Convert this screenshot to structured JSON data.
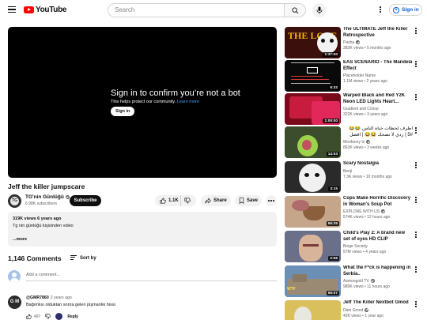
{
  "header": {
    "logo_text": "YouTube",
    "search_placeholder": "Search",
    "signin_label": "Sign in"
  },
  "player": {
    "overlay_title": "Sign in to confirm you’re not a bot",
    "overlay_subtitle": "This helps protect our community.",
    "overlay_link": "Learn more",
    "overlay_button": "Sign in"
  },
  "video": {
    "title": "Jeff the killer jumpscare",
    "channel_name": "TG'nin Günlüğü",
    "channel_avatar_text": "TG",
    "subscribers": "6.98K subscribers",
    "subscribe_label": "Subscribe",
    "likes": "1.1K",
    "share_label": "Share",
    "save_label": "Save"
  },
  "description": {
    "meta": "319K views  6 years ago",
    "text": "Tg nin günlüğü kişisinden video",
    "more_label": "...more"
  },
  "comments": {
    "count_label": "1,146 Comments",
    "sort_label": "Sort by",
    "add_placeholder": "Add a comment...",
    "items": [
      {
        "avatar_text": "G M",
        "author": "@GMR7860",
        "time": "2 years ago",
        "text": "Bağımlısı olduktan sonra gelen pişmanlık hissi",
        "likes": "497",
        "reply_label": "Reply"
      }
    ]
  },
  "recommendations": [
    {
      "title": "The ULTIMATE Jeff the Killer Retrospective",
      "channel": "Pasha",
      "verified": true,
      "meta": "383K views • 5 months ago",
      "duration": "1:37:00",
      "thumb_text": "THE LORE"
    },
    {
      "title": "EAS SCENARIO - The Mandela Effect",
      "channel": "Placeholder Name",
      "verified": false,
      "meta": "1.1M views • 2 years ago",
      "duration": "6:32"
    },
    {
      "title": "Warped Black and Red Y2K Neon LED Lights Heart...",
      "channel": "Gradient and Colour",
      "verified": false,
      "meta": "322K views • 3 years ago",
      "duration": "1:00:00"
    },
    {
      "title": "اطرف لحظات حياة الناس 😂😂 #5 | ردي لا تضحك 😂😂 | افضل تجميعة قتل",
      "channel": "Monfunny tv",
      "verified": true,
      "meta": "863K views • 3 weeks ago",
      "duration": "14:53"
    },
    {
      "title": "Scary Nostalgia",
      "channel": "Benji",
      "verified": false,
      "meta": "7.3K views • 10 months ago",
      "duration": "3:15"
    },
    {
      "title": "Cops Make Horrific Discovery in Woman's Soup Pot",
      "channel": "EXPLORE WITH US",
      "verified": true,
      "meta": "574K views • 12 hours ago",
      "duration": "55:25"
    },
    {
      "title": "Child's Play 2: A brand new set of eyes HD CLIP",
      "channel": "Binge Society",
      "verified": false,
      "meta": "57M views • 4 years ago",
      "duration": "2:56"
    },
    {
      "title": "What the F*ck is happening in Serbia..",
      "channel": "Asmongold TV",
      "verified": true,
      "meta": "989K views • 11 hours ago",
      "duration": "59:07",
      "thumb_text": "WTF"
    },
    {
      "title": "Jeff The Killer Nextbot Gmod",
      "channel": "Dani Gmod",
      "verified": true,
      "meta": "42K views • 1 year ago"
    }
  ]
}
